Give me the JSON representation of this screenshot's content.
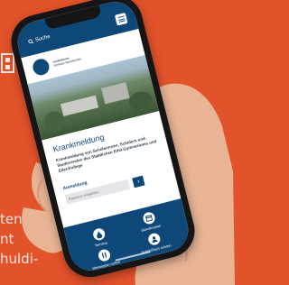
{
  "background": {
    "accent": "#e2522b",
    "text_lines": [
      "ten",
      "nt",
      "huldi-"
    ]
  },
  "app": {
    "topbar": {
      "search_label": "Suche"
    },
    "logo_lines": [
      "GEMEINSAM",
      "SCHULE GESTALTEN"
    ],
    "card": {
      "title": "Krankmeldung",
      "description": "Krankmeldung von Schülerinnen, Schülern und Studierenden des Staatlichen Eifel-Gymnasiums und Eifel-Kollegs",
      "login_label": "Anmeldung",
      "input_placeholder": "Passwort eingeben",
      "submit_label": "›"
    },
    "tiles": [
      {
        "label": "Termine",
        "icon": "drop-icon"
      },
      {
        "label": "Stundenplan",
        "icon": "calendar-icon"
      },
      {
        "label": "Mensaplan online",
        "icon": "food-icon"
      },
      {
        "label": "Schließfach mieten",
        "icon": "user-icon"
      }
    ],
    "colors": {
      "primary": "#0e4878",
      "screen_bg": "#f3f4f6"
    }
  }
}
